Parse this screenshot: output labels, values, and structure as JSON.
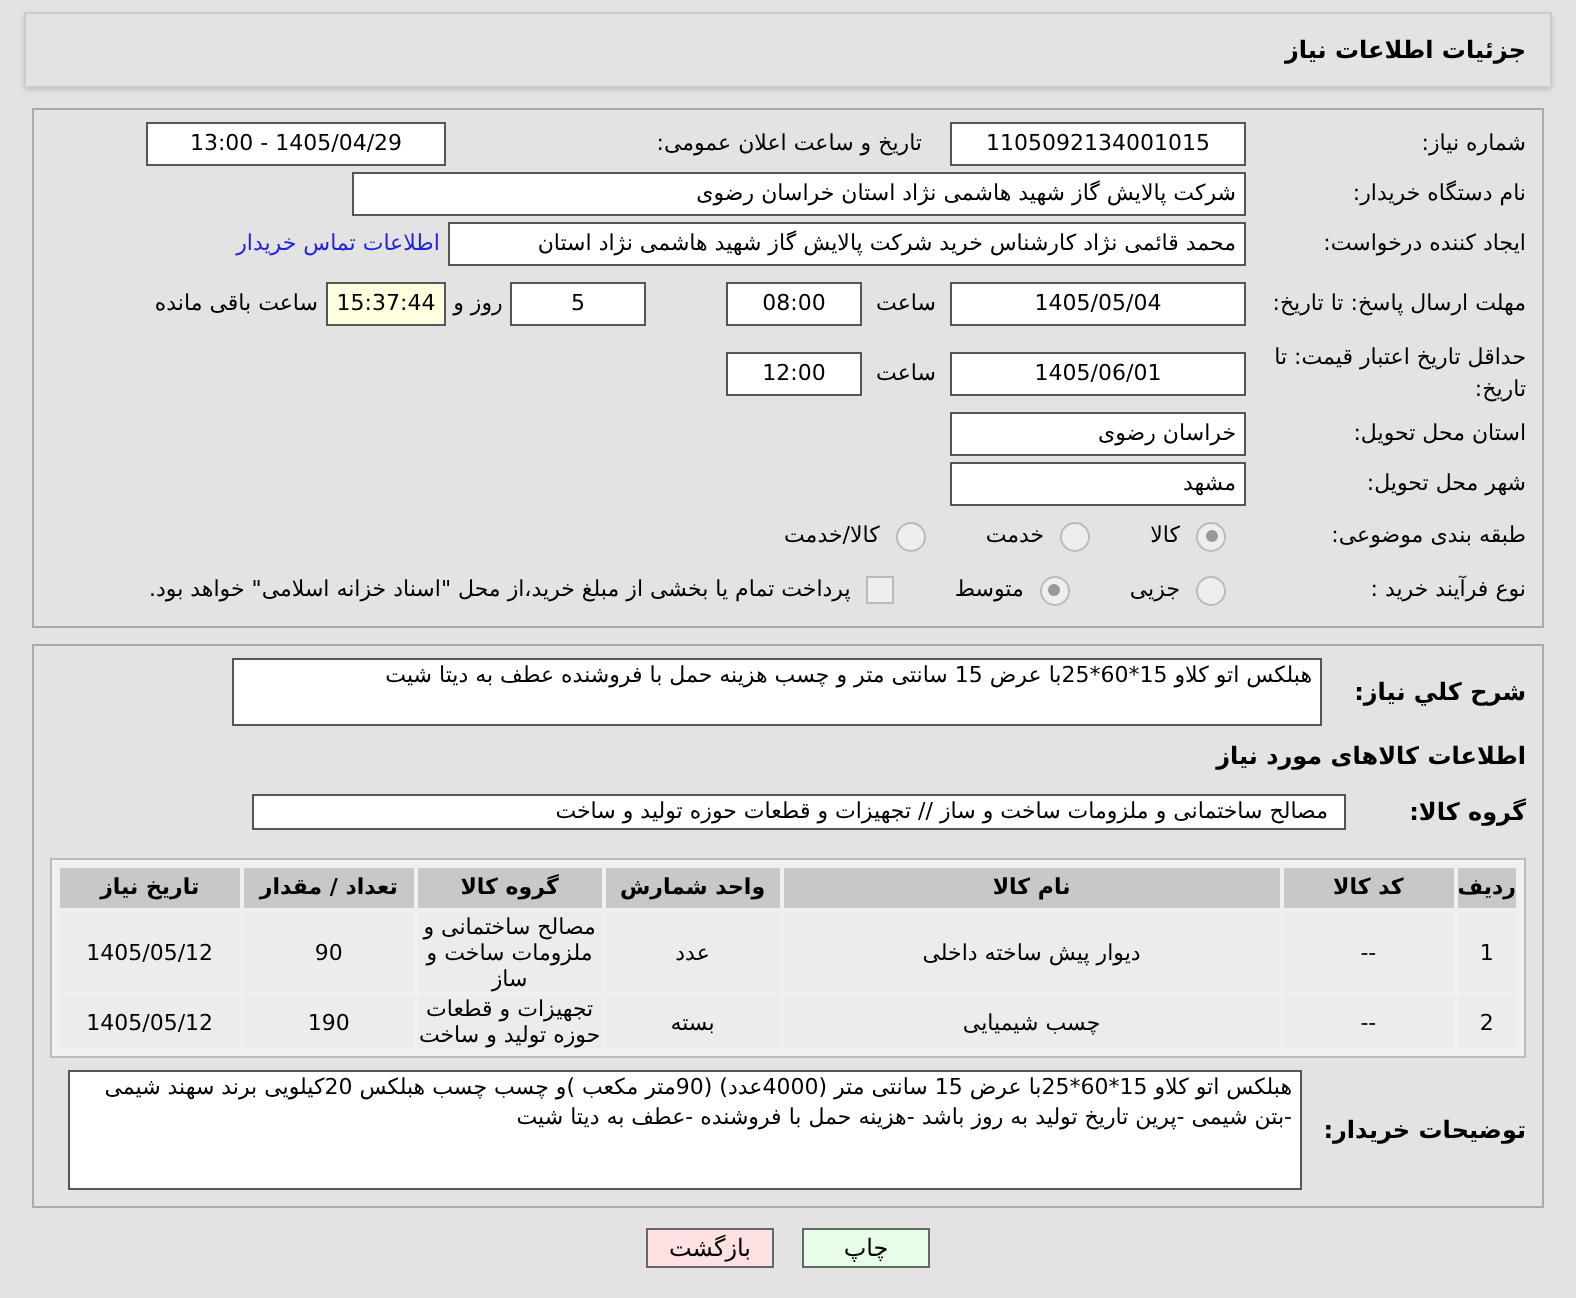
{
  "header": {
    "title": "جزئیات اطلاعات نیاز"
  },
  "need_number": {
    "label": "شماره نیاز:",
    "value": "1105092134001015"
  },
  "announce": {
    "label": "تاریخ و ساعت اعلان عمومی:",
    "value": "1405/04/29 - 13:00"
  },
  "buyer_org": {
    "label": "نام دستگاه خریدار:",
    "value": "شرکت پالایش گاز شهید هاشمی نژاد   استان خراسان رضوی"
  },
  "requester": {
    "label": "ایجاد کننده درخواست:",
    "value": "محمد قائمی نژاد کارشناس خرید  شرکت پالایش گاز شهید هاشمی نژاد   استان",
    "link": "اطلاعات تماس خریدار"
  },
  "reply_deadline": {
    "label": "مهلت ارسال پاسخ: تا تاریخ:",
    "date": "1405/05/04",
    "time_label": "ساعت",
    "time": "08:00",
    "days": "5",
    "days_label": "روز و",
    "remaining": "15:37:44",
    "remaining_label": "ساعت باقی مانده"
  },
  "price_validity": {
    "label": "حداقل تاریخ اعتبار قیمت: تا تاریخ:",
    "date": "1405/06/01",
    "time_label": "ساعت",
    "time": "12:00"
  },
  "province": {
    "label": "استان محل تحویل:",
    "value": "خراسان رضوی"
  },
  "city": {
    "label": "شهر محل تحویل:",
    "value": "مشهد"
  },
  "category": {
    "label": "طبقه بندی موضوعی:",
    "options": [
      {
        "label": "کالا",
        "selected": true
      },
      {
        "label": "خدمت",
        "selected": false
      },
      {
        "label": "کالا/خدمت",
        "selected": false
      }
    ]
  },
  "purchase_type": {
    "label": "نوع فرآیند خرید :",
    "options": [
      {
        "label": "جزیی",
        "selected": false
      },
      {
        "label": "متوسط",
        "selected": true
      }
    ],
    "payment": {
      "label": "پرداخت تمام یا بخشی از مبلغ خرید،از محل \"اسناد خزانه اسلامی\" خواهد بود.",
      "checked": false
    }
  },
  "description": {
    "label": "شرح کلي نياز:",
    "value": "هبلکس اتو کلاو 15*60*25با عرض 15 سانتی متر و چسب هزینه حمل با فروشنده عطف به دیتا شیت"
  },
  "items_heading": "اطلاعات کالاهای مورد نیاز",
  "goods_group": {
    "label": "گروه کالا:",
    "value": "مصالح ساختمانی و ملزومات ساخت و ساز // تجهیزات و قطعات حوزه تولید و ساخت"
  },
  "table": {
    "columns": [
      "ردیف",
      "کد کالا",
      "نام کالا",
      "واحد شمارش",
      "گروه کالا",
      "تعداد / مقدار",
      "تاریخ نیاز"
    ],
    "rows": [
      [
        "1",
        "--",
        "دیوار پیش ساخته داخلی",
        "عدد",
        "مصالح ساختمانی و ملزومات ساخت و ساز",
        "90",
        "1405/05/12"
      ],
      [
        "2",
        "--",
        "چسب شیمیایی",
        "بسته",
        "تجهیزات و قطعات حوزه تولید و ساخت",
        "190",
        "1405/05/12"
      ]
    ]
  },
  "buyer_notes": {
    "label": "توضیحات خریدار:",
    "value": "هبلکس اتو کلاو 15*60*25با عرض 15 سانتی متر (4000عدد) (90متر مکعب )و چسب چسب هبلکس 20کیلویی برند سهند شیمی -بتن شیمی -پرین تاریخ تولید به روز باشد -هزینه حمل با فروشنده -عطف به دیتا شیت"
  },
  "buttons": [
    {
      "label": "چاپ",
      "kind": "print"
    },
    {
      "label": "بازگشت",
      "kind": "back"
    }
  ]
}
